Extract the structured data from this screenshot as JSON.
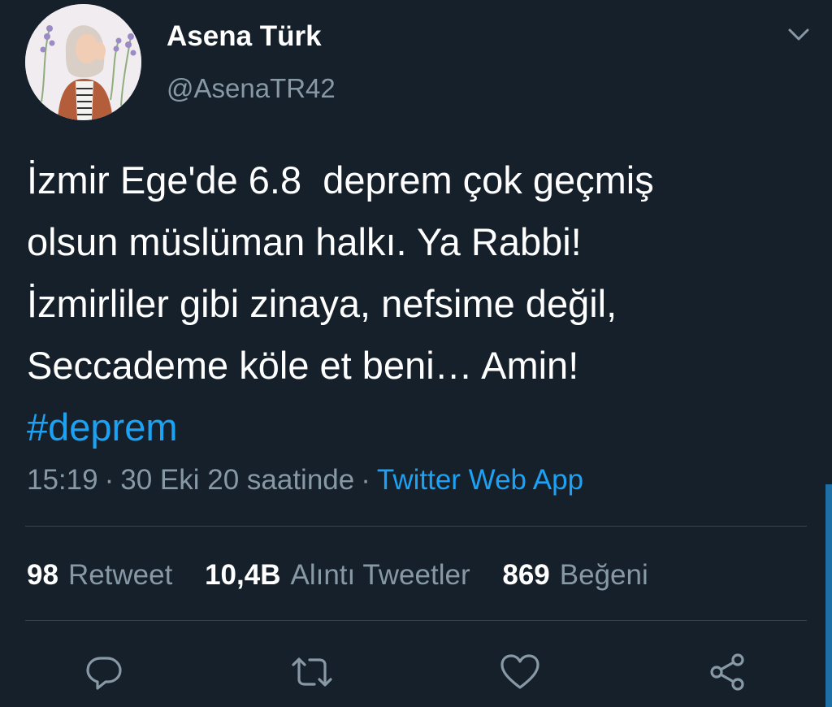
{
  "tweet": {
    "author": {
      "display_name": "Asena Türk",
      "handle": "@AsenaTR42"
    },
    "text_lines": [
      "İzmir Ege'de 6.8  deprem çok geçmiş",
      "olsun müslüman halkı. Ya Rabbi!",
      "İzmirliler gibi zinaya, nefsime değil,",
      "Seccademe köle et beni… Amin!"
    ],
    "hashtag": "#deprem",
    "time": "15:19",
    "date": "30 Eki 20 saatinde",
    "separator": "·",
    "source": "Twitter Web App",
    "stats": {
      "retweets_count": "98",
      "retweets_label": "Retweet",
      "quotes_count": "10,4B",
      "quotes_label": "Alıntı Tweetler",
      "likes_count": "869",
      "likes_label": "Beğeni"
    }
  },
  "icons": {
    "caret": "chevron-down-icon",
    "reply": "reply-icon",
    "retweet": "retweet-icon",
    "like": "heart-icon",
    "share": "share-icon"
  },
  "colors": {
    "background": "#15202b",
    "primary_text": "#ffffff",
    "secondary_text": "#8899a6",
    "accent": "#1da1f2",
    "divider": "#38444d"
  }
}
